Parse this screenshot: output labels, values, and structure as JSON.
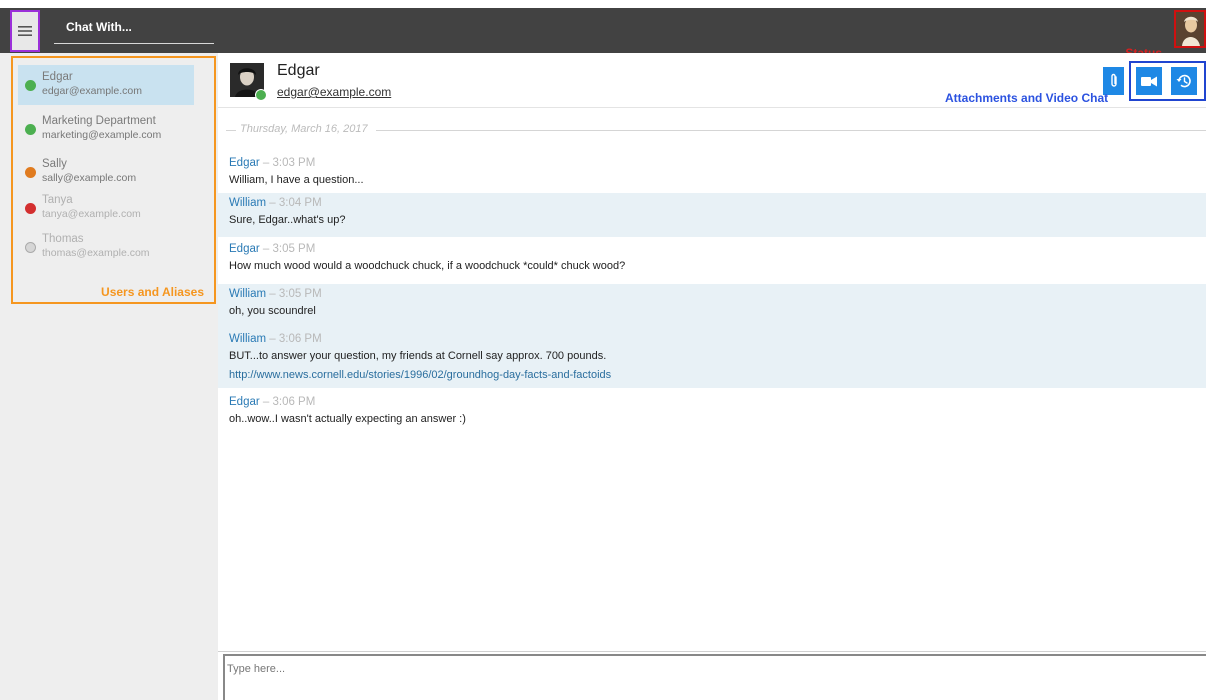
{
  "header": {
    "chat_with_label": "Chat With...",
    "status_label": "Status"
  },
  "sidebar": {
    "users": [
      {
        "name": "Edgar",
        "email": "edgar@example.com",
        "status_color": "#4caf50"
      },
      {
        "name": "Marketing Department",
        "email": "marketing@example.com",
        "status_color": "#4caf50"
      },
      {
        "name": "Sally",
        "email": "sally@example.com",
        "status_color": "#e07b1f"
      },
      {
        "name": "Tanya",
        "email": "tanya@example.com",
        "status_color": "#d32f2f"
      },
      {
        "name": "Thomas",
        "email": "thomas@example.com",
        "status_color": "#d0d0d0"
      }
    ],
    "annotation_label": "Users and Aliases"
  },
  "chat": {
    "contact_name": "Edgar",
    "contact_email": "edgar@example.com",
    "annotation_label": "Attachments and Video Chat",
    "date_separator": "Thursday, March 16, 2017",
    "messages": [
      {
        "sender": "Edgar",
        "time": "– 3:03 PM",
        "text": "William, I have a question..."
      },
      {
        "sender": "William",
        "time": "– 3:04 PM",
        "text": "Sure, Edgar..what's up?"
      },
      {
        "sender": "Edgar",
        "time": "– 3:05 PM",
        "text": "How much wood would a woodchuck chuck, if a woodchuck *could* chuck wood?"
      },
      {
        "sender": "William",
        "time": "– 3:05 PM",
        "text": "oh, you scoundrel"
      },
      {
        "sender": "William",
        "time": "– 3:06 PM",
        "text": "BUT...to answer your question, my friends at Cornell say approx. 700 pounds.",
        "link": "http://www.news.cornell.edu/stories/1996/02/groundhog-day-facts-and-factoids"
      },
      {
        "sender": "Edgar",
        "time": "– 3:06 PM",
        "text": "oh..wow..I wasn't actually expecting an answer :)"
      }
    ],
    "composer_placeholder": "Type here..."
  },
  "icons": {
    "menu": "hamburger-icon",
    "attach": "paperclip-icon",
    "video": "video-camera-icon",
    "history": "history-icon"
  },
  "colors": {
    "topbar": "#424242",
    "accent_blue": "#1e88e5",
    "sender_blue": "#2a7ab5",
    "annotation_orange": "#f5961f",
    "annotation_blue": "#2045d0",
    "annotation_purple": "#9b30d9",
    "annotation_red": "#d01010"
  }
}
